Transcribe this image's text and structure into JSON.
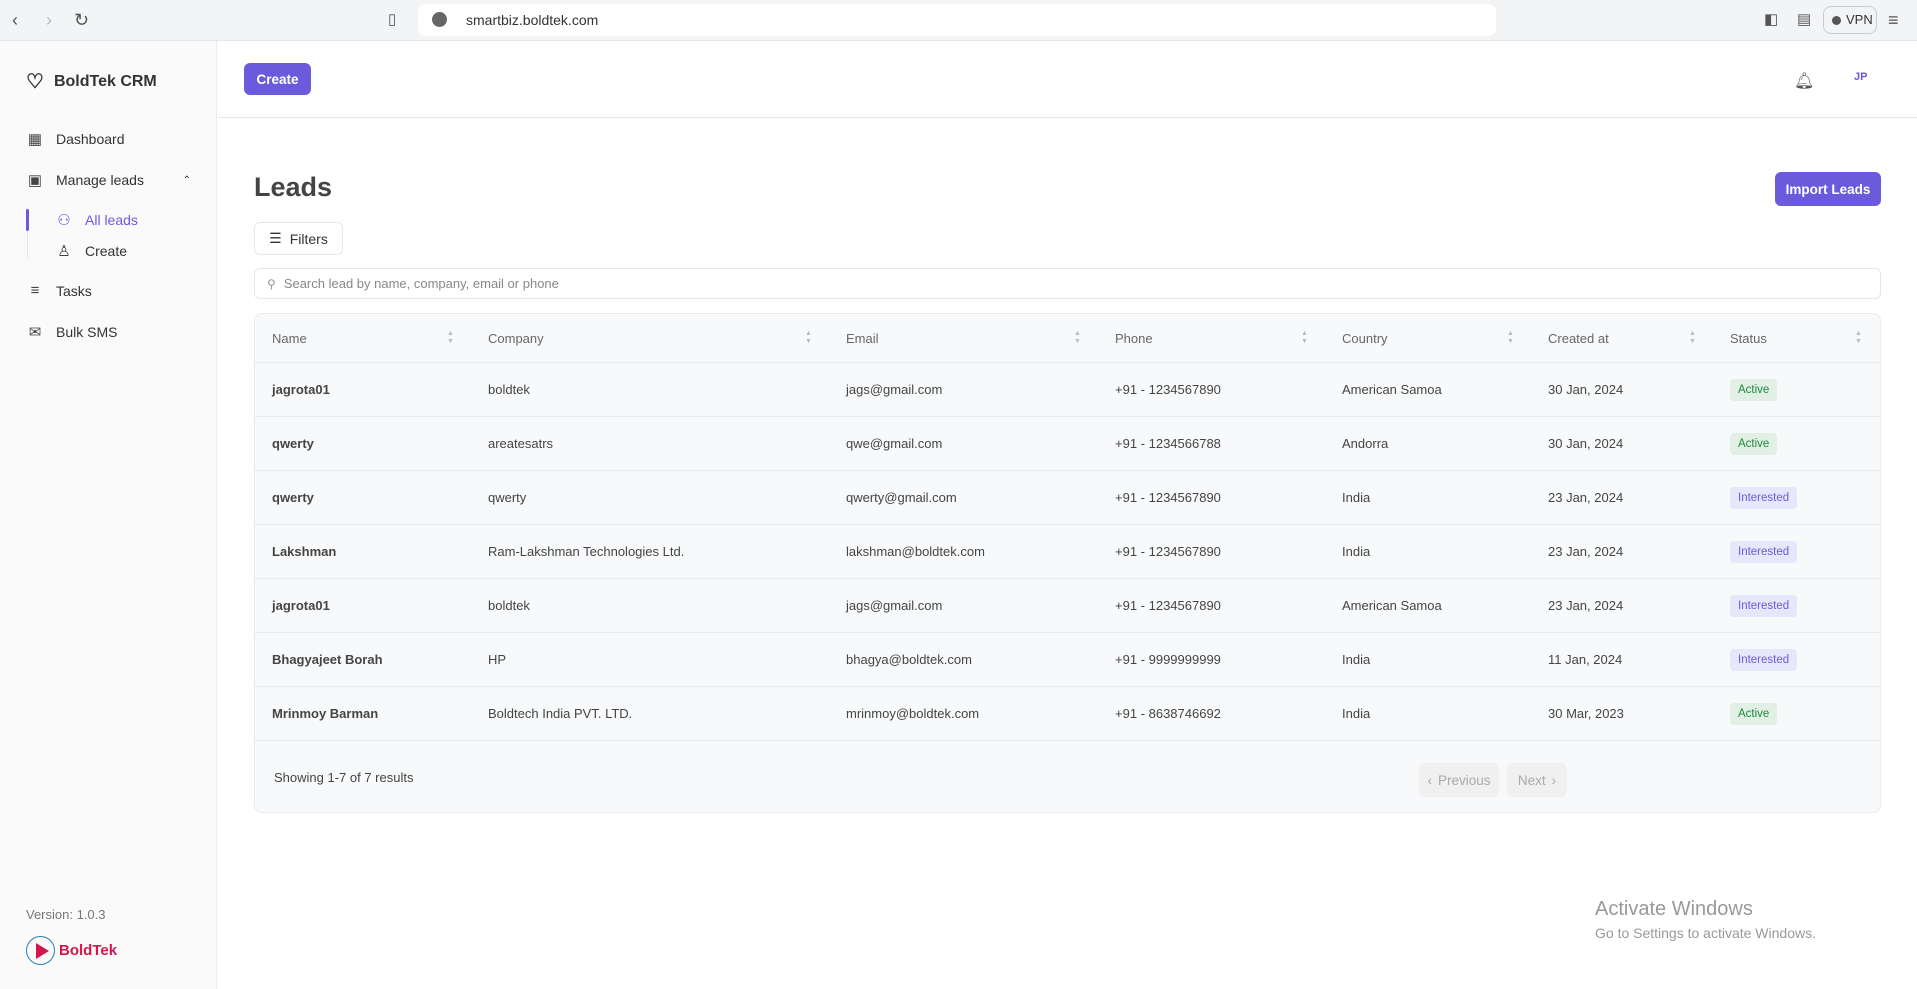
{
  "browser": {
    "url": "smartbiz.boldtek.com",
    "vpn_label": "VPN"
  },
  "sidebar": {
    "brand": "BoldTek CRM",
    "items": [
      {
        "label": "Dashboard",
        "icon": "grid-icon"
      },
      {
        "label": "Manage leads",
        "icon": "inbox-icon"
      },
      {
        "label": "All leads",
        "icon": "users-icon"
      },
      {
        "label": "Create",
        "icon": "user-plus-icon"
      },
      {
        "label": "Tasks",
        "icon": "layers-icon"
      },
      {
        "label": "Bulk SMS",
        "icon": "message-icon"
      }
    ],
    "version": "Version: 1.0.3",
    "logo_text": "BoldTek"
  },
  "header": {
    "create_label": "Create",
    "avatar_initials": "JP"
  },
  "main": {
    "title": "Leads",
    "import_label": "Import Leads",
    "filters_label": "Filters",
    "search_placeholder": "Search lead by name, company, email or phone"
  },
  "table": {
    "columns": [
      "Name",
      "Company",
      "Email",
      "Phone",
      "Country",
      "Created at",
      "Status"
    ],
    "rows": [
      [
        "jagrota01",
        "boldtek",
        "jags@gmail.com",
        "+91 - 1234567890",
        "American Samoa",
        "30 Jan, 2024",
        "Active"
      ],
      [
        "qwerty",
        "areatesatrs",
        "qwe@gmail.com",
        "+91 - 1234566788",
        "Andorra",
        "30 Jan, 2024",
        "Active"
      ],
      [
        "qwerty",
        "qwerty",
        "qwerty@gmail.com",
        "+91 - 1234567890",
        "India",
        "23 Jan, 2024",
        "Interested"
      ],
      [
        "Lakshman",
        "Ram-Lakshman Technologies Ltd.",
        "lakshman@boldtek.com",
        "+91 - 1234567890",
        "India",
        "23 Jan, 2024",
        "Interested"
      ],
      [
        "jagrota01",
        "boldtek",
        "jags@gmail.com",
        "+91 - 1234567890",
        "American Samoa",
        "23 Jan, 2024",
        "Interested"
      ],
      [
        "Bhagyajeet Borah",
        "HP",
        "bhagya@boldtek.com",
        "+91 - 9999999999",
        "India",
        "11 Jan, 2024",
        "Interested"
      ],
      [
        "Mrinmoy Barman",
        "Boldtech India PVT. LTD.",
        "mrinmoy@boldtek.com",
        "+91 - 8638746692",
        "India",
        "30 Mar, 2023",
        "Active"
      ]
    ],
    "showing_text": "Showing 1-7 of 7 results",
    "previous_label": "Previous",
    "next_label": "Next"
  },
  "colors": {
    "accent": "#6b5bdc",
    "active_bg": "#e1efe4",
    "active_text": "#1e8a3a",
    "interested_bg": "#e6e7fa"
  },
  "watermark": {
    "line1": "Activate Windows",
    "line2": "Go to Settings to activate Windows."
  }
}
